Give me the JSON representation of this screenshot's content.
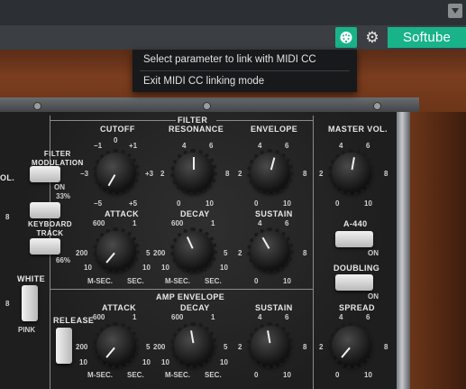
{
  "host": {
    "dropdown_icon": "caret-down-icon"
  },
  "plugin_bar": {
    "midi_icon": "midi-link-icon",
    "gear_icon": "gear-icon",
    "brand": "Softube"
  },
  "context_menu": {
    "items": [
      {
        "label": "Select parameter to link with MIDI CC"
      },
      {
        "label": "Exit MIDI CC linking mode"
      }
    ]
  },
  "synth": {
    "section_filter": "FILTER",
    "section_amp_env": "AMP ENVELOPE",
    "left_cut": "OL.",
    "filter_modulation": "FILTER\nMODULATION",
    "filter_mod_on": "ON",
    "kbd_33": "33%",
    "keyboard_track": "KEYBOARD\nTRACK",
    "kbd_66": "66%",
    "white": "WHITE",
    "pink": "PINK",
    "release": "RELEASE",
    "cutoff": "CUTOFF",
    "resonance": "RESONANCE",
    "envelope": "ENVELOPE",
    "attack": "ATTACK",
    "decay": "DECAY",
    "sustain": "SUSTAIN",
    "master_vol": "MASTER VOL.",
    "a440": "A-440",
    "on": "ON",
    "doubling": "DOUBLING",
    "spread": "SPREAD",
    "msec": "M-SEC.",
    "sec": "SEC.",
    "scale": {
      "cutoff_top": "0",
      "cutoff_m1": "−1",
      "cutoff_p1": "+1",
      "cutoff_m3": "−3",
      "cutoff_p3": "+3",
      "cutoff_m5": "−5",
      "cutoff_p5": "+5",
      "n0": "0",
      "n2": "2",
      "n4": "4",
      "n6": "6",
      "n8": "8",
      "n10": "10",
      "t600": "600",
      "t200": "200",
      "t1": "1",
      "t5": "5"
    }
  }
}
